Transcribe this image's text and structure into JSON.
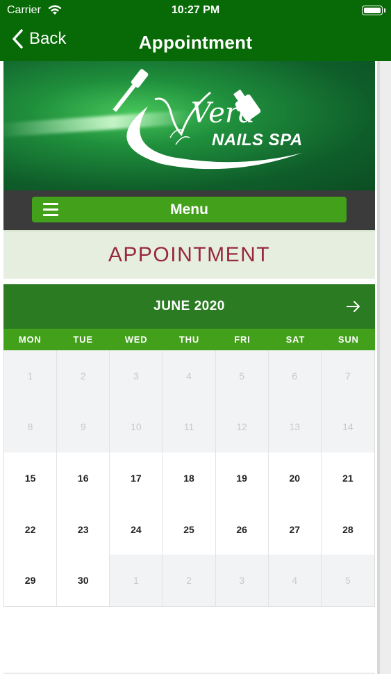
{
  "status_bar": {
    "carrier": "Carrier",
    "time": "10:27 PM"
  },
  "nav": {
    "back_label": "Back",
    "title": "Appointment"
  },
  "banner": {
    "logo_script": "Vera",
    "logo_text": "NAILS SPA"
  },
  "menu": {
    "label": "Menu"
  },
  "section": {
    "heading": "APPOINTMENT"
  },
  "calendar": {
    "month_label": "JUNE 2020",
    "weekdays": [
      "MON",
      "TUE",
      "WED",
      "THU",
      "FRI",
      "SAT",
      "SUN"
    ],
    "days": [
      {
        "d": "1",
        "active": false
      },
      {
        "d": "2",
        "active": false
      },
      {
        "d": "3",
        "active": false
      },
      {
        "d": "4",
        "active": false
      },
      {
        "d": "5",
        "active": false
      },
      {
        "d": "6",
        "active": false
      },
      {
        "d": "7",
        "active": false
      },
      {
        "d": "8",
        "active": false
      },
      {
        "d": "9",
        "active": false
      },
      {
        "d": "10",
        "active": false
      },
      {
        "d": "11",
        "active": false
      },
      {
        "d": "12",
        "active": false
      },
      {
        "d": "13",
        "active": false
      },
      {
        "d": "14",
        "active": false
      },
      {
        "d": "15",
        "active": true
      },
      {
        "d": "16",
        "active": true
      },
      {
        "d": "17",
        "active": true
      },
      {
        "d": "18",
        "active": true
      },
      {
        "d": "19",
        "active": true
      },
      {
        "d": "20",
        "active": true
      },
      {
        "d": "21",
        "active": true
      },
      {
        "d": "22",
        "active": true
      },
      {
        "d": "23",
        "active": true
      },
      {
        "d": "24",
        "active": true
      },
      {
        "d": "25",
        "active": true
      },
      {
        "d": "26",
        "active": true
      },
      {
        "d": "27",
        "active": true
      },
      {
        "d": "28",
        "active": true
      },
      {
        "d": "29",
        "active": true
      },
      {
        "d": "30",
        "active": true
      },
      {
        "d": "1",
        "active": false
      },
      {
        "d": "2",
        "active": false
      },
      {
        "d": "3",
        "active": false
      },
      {
        "d": "4",
        "active": false
      },
      {
        "d": "5",
        "active": false
      }
    ]
  },
  "colors": {
    "nav_bg": "#086a06",
    "accent_green": "#43a01b",
    "header_green": "#2b7b22",
    "heading_red": "#98283b"
  }
}
